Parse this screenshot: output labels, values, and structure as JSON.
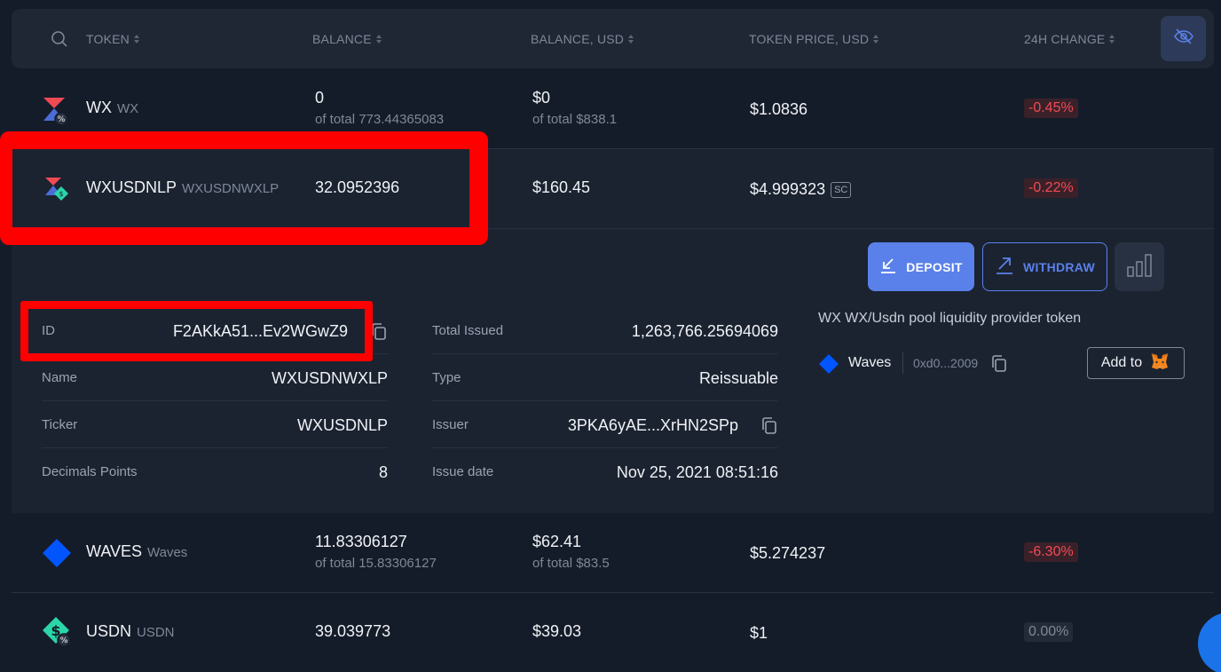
{
  "header": {
    "columns": [
      "TOKEN",
      "BALANCE",
      "BALANCE, USD",
      "TOKEN PRICE, USD",
      "24H CHANGE"
    ]
  },
  "rows": [
    {
      "name": "WX",
      "ticker": "WX",
      "balance": "0",
      "balance_total": "of total 773.44365083",
      "usd": "$0",
      "usd_total": "of total $838.1",
      "price": "$1.0836",
      "change": "-0.45%"
    },
    {
      "name": "WXUSDNLP",
      "ticker": "WXUSDNWXLP",
      "balance": "32.0952396",
      "usd": "$160.45",
      "price": "$4.999323",
      "price_badge": "SC",
      "change": "-0.22%"
    },
    {
      "name": "WAVES",
      "ticker": "Waves",
      "balance": "11.83306127",
      "balance_total": "of total 15.83306127",
      "usd": "$62.41",
      "usd_total": "of total $83.5",
      "price": "$5.274237",
      "change": "-6.30%"
    },
    {
      "name": "USDN",
      "ticker": "USDN",
      "balance": "39.039773",
      "usd": "$39.03",
      "price": "$1",
      "change": "0.00%"
    }
  ],
  "details": {
    "left": [
      {
        "label": "ID",
        "value": "F2AKkA51...Ev2WGwZ9"
      },
      {
        "label": "Name",
        "value": "WXUSDNWXLP"
      },
      {
        "label": "Ticker",
        "value": "WXUSDNLP"
      },
      {
        "label": "Decimals Points",
        "value": "8"
      }
    ],
    "right": [
      {
        "label": "Total Issued",
        "value": "1,263,766.25694069"
      },
      {
        "label": "Type",
        "value": "Reissuable"
      },
      {
        "label": "Issuer",
        "value": "3PKA6yAE...XrHN2SPp"
      },
      {
        "label": "Issue date",
        "value": "Nov 25, 2021 08:51:16"
      }
    ],
    "description": "WX WX/Usdn pool liquidity provider token",
    "network": "Waves",
    "contract": "0xd0...2009",
    "add_to_label": "Add to"
  },
  "actions": {
    "deposit": "DEPOSIT",
    "withdraw": "WITHDRAW"
  },
  "colors": {
    "accent": "#5a81ea",
    "negative": "#f04a55",
    "highlight": "#ff0000"
  }
}
